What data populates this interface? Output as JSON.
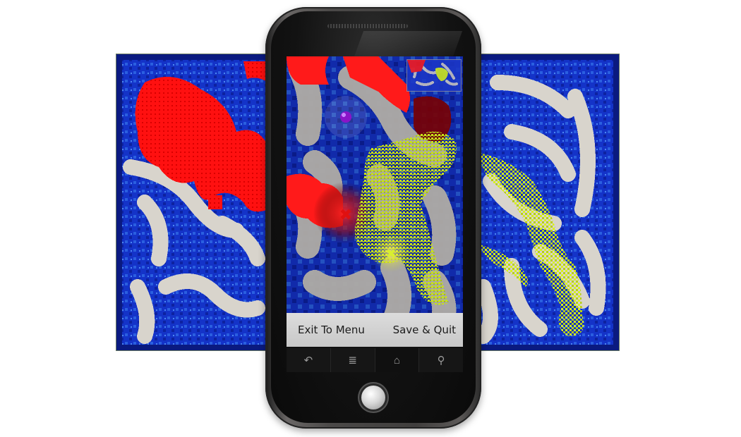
{
  "game": {
    "menu": {
      "exit_label": "Exit To Menu",
      "save_label": "Save & Quit"
    },
    "players": [
      {
        "color": "#ff1a1a",
        "marker": "x"
      },
      {
        "color": "#d8ef1a",
        "marker": "x"
      }
    ],
    "colors": {
      "water": "#1433c8",
      "path": "#d8d4cc",
      "red_paint": "#ff1010",
      "yellow_paint": "#d8f21a",
      "purple_ball": "#8a14c8"
    }
  },
  "device": {
    "softkeys": [
      {
        "name": "back-key",
        "glyph": "↶"
      },
      {
        "name": "menu-key",
        "glyph": "≣"
      },
      {
        "name": "home-key",
        "glyph": "⌂"
      },
      {
        "name": "search-key",
        "glyph": "⚲"
      }
    ]
  }
}
